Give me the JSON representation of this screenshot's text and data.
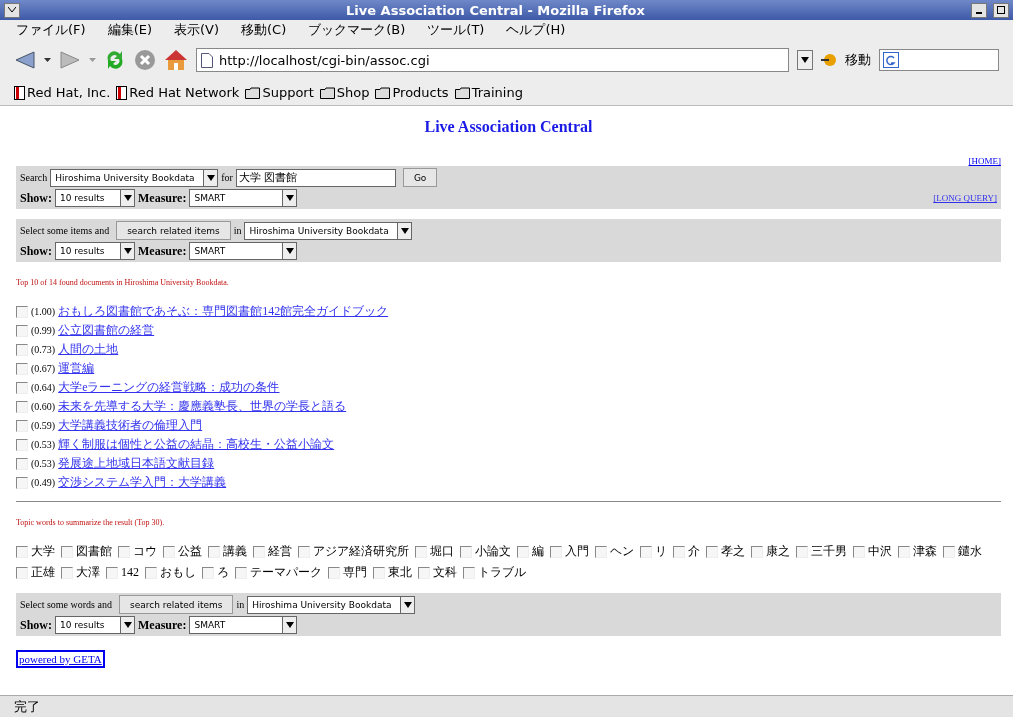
{
  "window": {
    "title": "Live Association Central - Mozilla Firefox"
  },
  "menu": [
    "ファイル(F)",
    "編集(E)",
    "表示(V)",
    "移動(C)",
    "ブックマーク(B)",
    "ツール(T)",
    "ヘルプ(H)"
  ],
  "toolbar": {
    "url": "http://localhost/cgi-bin/assoc.cgi",
    "go_label": "移動"
  },
  "bookmarks": [
    {
      "label": "Red Hat, Inc.",
      "kind": "book"
    },
    {
      "label": "Red Hat Network",
      "kind": "book"
    },
    {
      "label": "Support",
      "kind": "folder"
    },
    {
      "label": "Shop",
      "kind": "folder"
    },
    {
      "label": "Products",
      "kind": "folder"
    },
    {
      "label": "Training",
      "kind": "folder"
    }
  ],
  "page": {
    "heading": "Live Association Central",
    "home_link": "[HOME]",
    "search_panel": {
      "label": "Search",
      "source": "Hiroshima University Bookdata",
      "for_label": "for",
      "query": "大学 図書館",
      "go": "Go",
      "show_label": "Show:",
      "show_value": "10 results",
      "measure_label": "Measure:",
      "measure_value": "SMART",
      "long_query": "[LONG QUERY]"
    },
    "items_panel": {
      "lead": "Select some items and",
      "button": "search related items",
      "in_label": "in",
      "source": "Hiroshima University Bookdata",
      "show_label": "Show:",
      "show_value": "10 results",
      "measure_label": "Measure:",
      "measure_value": "SMART"
    },
    "results_caption": "Top 10 of 14 found documents in Hiroshima University Bookdata.",
    "results": [
      {
        "score": "(1.00)",
        "title": "おもしろ図書館であそぶ：専門図書館142館完全ガイドブック",
        "checked": false
      },
      {
        "score": "(0.99)",
        "title": "公立図書館の経営",
        "checked": false
      },
      {
        "score": "(0.73)",
        "title": "人間の土地",
        "checked": false
      },
      {
        "score": "(0.67)",
        "title": "運営編",
        "checked": false
      },
      {
        "score": "(0.64)",
        "title": "大学eラーニングの経営戦略：成功の条件",
        "checked": false
      },
      {
        "score": "(0.60)",
        "title": "未来を先導する大学：慶應義塾長、世界の学長と語る",
        "checked": false
      },
      {
        "score": "(0.59)",
        "title": "大学講義技術者の倫理入門",
        "checked": false
      },
      {
        "score": "(0.53)",
        "title": "輝く制服は個性と公益の結晶：高校生・公益小論文",
        "checked": false
      },
      {
        "score": "(0.53)",
        "title": "発展途上地域日本語文献目録",
        "checked": false
      },
      {
        "score": "(0.49)",
        "title": "交渉システム学入門：大学講義",
        "checked": false
      }
    ],
    "topics_caption": "Topic words to summarize the result (Top 30).",
    "topics": [
      {
        "label": "大学",
        "checked": false
      },
      {
        "label": "図書館",
        "checked": false
      },
      {
        "label": "コウ",
        "checked": false
      },
      {
        "label": "公益",
        "checked": false
      },
      {
        "label": "講義",
        "checked": false
      },
      {
        "label": "経営",
        "checked": false
      },
      {
        "label": "アジア経済研究所",
        "checked": false
      },
      {
        "label": "堀口",
        "checked": false
      },
      {
        "label": "小論文",
        "checked": false
      },
      {
        "label": "編",
        "checked": false
      },
      {
        "label": "入門",
        "checked": false
      },
      {
        "label": "ヘン",
        "checked": false
      },
      {
        "label": "リ",
        "checked": false
      },
      {
        "label": "介",
        "checked": false
      },
      {
        "label": "孝之",
        "checked": false
      },
      {
        "label": "康之",
        "checked": false
      },
      {
        "label": "三千男",
        "checked": false
      },
      {
        "label": "中沢",
        "checked": false
      },
      {
        "label": "津森",
        "checked": false
      },
      {
        "label": "鑓水",
        "checked": false
      },
      {
        "label": "正雄",
        "checked": false
      },
      {
        "label": "大澤",
        "checked": false
      },
      {
        "label": "142",
        "checked": false
      },
      {
        "label": "おもし",
        "checked": false
      },
      {
        "label": "ろ",
        "checked": false
      },
      {
        "label": "テーマパーク",
        "checked": false
      },
      {
        "label": "専門",
        "checked": false
      },
      {
        "label": "東北",
        "checked": false
      },
      {
        "label": "文科",
        "checked": false
      },
      {
        "label": "トラブル",
        "checked": false
      }
    ],
    "words_panel": {
      "lead": "Select some words and",
      "button": "search related items",
      "in_label": "in",
      "source": "Hiroshima University Bookdata",
      "show_label": "Show:",
      "show_value": "10 results",
      "measure_label": "Measure:",
      "measure_value": "SMART"
    },
    "footer_link": "powered by GETA"
  },
  "status_bar": {
    "text": "完了"
  }
}
